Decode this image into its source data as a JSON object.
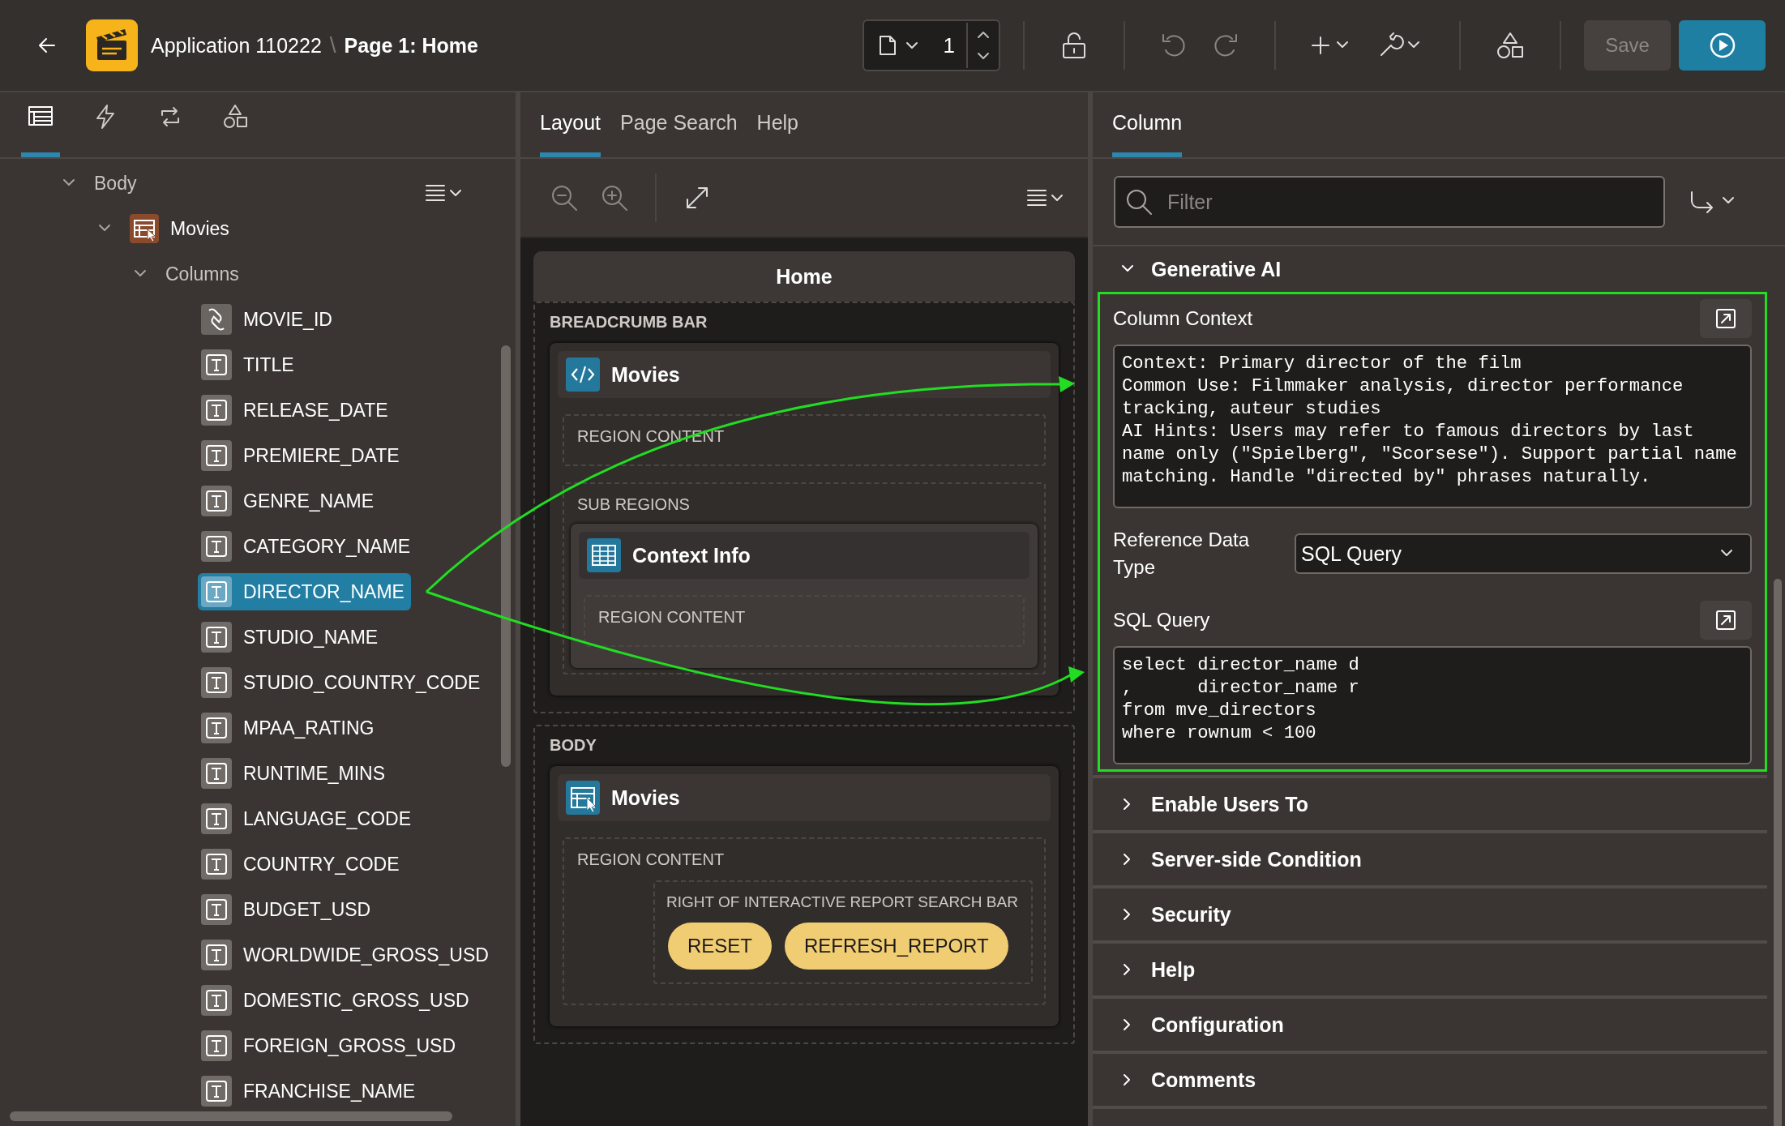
{
  "header": {
    "app_title": "Application 110222",
    "separator": "\\",
    "page_title": "Page 1: Home",
    "page_number": "1",
    "save": {
      "label": "Save",
      "disabled": true
    }
  },
  "left_tabs": [
    {
      "selected": true
    },
    {
      "selected": false
    },
    {
      "selected": false
    },
    {
      "selected": false
    }
  ],
  "tree": [
    {
      "label": "Body",
      "kind": "group",
      "expanded": true,
      "children": [
        {
          "label": "Movies",
          "kind": "report",
          "expanded": true,
          "children": [
            {
              "label": "Columns",
              "kind": "group",
              "expanded": true,
              "children": [
                {
                  "label": "MOVIE_ID",
                  "kind": "link",
                  "selected": false
                },
                {
                  "label": "TITLE",
                  "kind": "text",
                  "selected": false
                },
                {
                  "label": "RELEASE_DATE",
                  "kind": "text",
                  "selected": false
                },
                {
                  "label": "PREMIERE_DATE",
                  "kind": "text",
                  "selected": false
                },
                {
                  "label": "GENRE_NAME",
                  "kind": "text",
                  "selected": false
                },
                {
                  "label": "CATEGORY_NAME",
                  "kind": "text",
                  "selected": false
                },
                {
                  "label": "DIRECTOR_NAME",
                  "kind": "text",
                  "selected": true
                },
                {
                  "label": "STUDIO_NAME",
                  "kind": "text",
                  "selected": false
                },
                {
                  "label": "STUDIO_COUNTRY_CODE",
                  "kind": "text",
                  "selected": false
                },
                {
                  "label": "MPAA_RATING",
                  "kind": "text",
                  "selected": false
                },
                {
                  "label": "RUNTIME_MINS",
                  "kind": "text",
                  "selected": false
                },
                {
                  "label": "LANGUAGE_CODE",
                  "kind": "text",
                  "selected": false
                },
                {
                  "label": "COUNTRY_CODE",
                  "kind": "text",
                  "selected": false
                },
                {
                  "label": "BUDGET_USD",
                  "kind": "text",
                  "selected": false
                },
                {
                  "label": "WORLDWIDE_GROSS_USD",
                  "kind": "text",
                  "selected": false
                },
                {
                  "label": "DOMESTIC_GROSS_USD",
                  "kind": "text",
                  "selected": false
                },
                {
                  "label": "FOREIGN_GROSS_USD",
                  "kind": "text",
                  "selected": false
                },
                {
                  "label": "FRANCHISE_NAME",
                  "kind": "text",
                  "selected": false
                }
              ]
            }
          ]
        }
      ]
    }
  ],
  "middle_tabs": [
    {
      "label": "Layout",
      "selected": true
    },
    {
      "label": "Page Search",
      "selected": false
    },
    {
      "label": "Help",
      "selected": false
    }
  ],
  "layout": {
    "page_title": "Home",
    "zones": [
      {
        "label": "BREADCRUMB BAR",
        "regions": [
          {
            "title": "Movies",
            "kind": "static",
            "content_label": "REGION CONTENT",
            "sub_regions_label": "SUB REGIONS",
            "sub_regions": [
              {
                "title": "Context Info",
                "kind": "classic",
                "content_label": "REGION CONTENT"
              }
            ]
          }
        ]
      },
      {
        "label": "BODY",
        "regions": [
          {
            "title": "Movies",
            "kind": "report",
            "content_label": "REGION CONTENT",
            "slot_label": "RIGHT OF INTERACTIVE REPORT SEARCH BAR",
            "buttons": [
              "RESET",
              "REFRESH_REPORT"
            ]
          }
        ]
      }
    ]
  },
  "right_tab": {
    "label": "Column",
    "selected": true
  },
  "filter": {
    "placeholder": "Filter"
  },
  "sections": [
    {
      "title": "Generative AI",
      "expanded": true,
      "highlighted": true,
      "fields": [
        {
          "kind": "textarea",
          "label": "Column Context",
          "value": "Context: Primary director of the film\nCommon Use: Filmmaker analysis, director performance tracking, auteur studies\nAI Hints: Users may refer to famous directors by last name only (\"Spielberg\", \"Scorsese\"). Support partial name matching. Handle \"directed by\" phrases naturally."
        },
        {
          "kind": "select",
          "label": "Reference Data Type",
          "value": "SQL Query"
        },
        {
          "kind": "textarea",
          "label": "SQL Query",
          "value": "select director_name d\n,      director_name r\nfrom mve_directors\nwhere rownum < 100"
        }
      ]
    },
    {
      "title": "Enable Users To",
      "expanded": false
    },
    {
      "title": "Server-side Condition",
      "expanded": false
    },
    {
      "title": "Security",
      "expanded": false
    },
    {
      "title": "Help",
      "expanded": false
    },
    {
      "title": "Configuration",
      "expanded": false
    },
    {
      "title": "Comments",
      "expanded": false
    }
  ]
}
